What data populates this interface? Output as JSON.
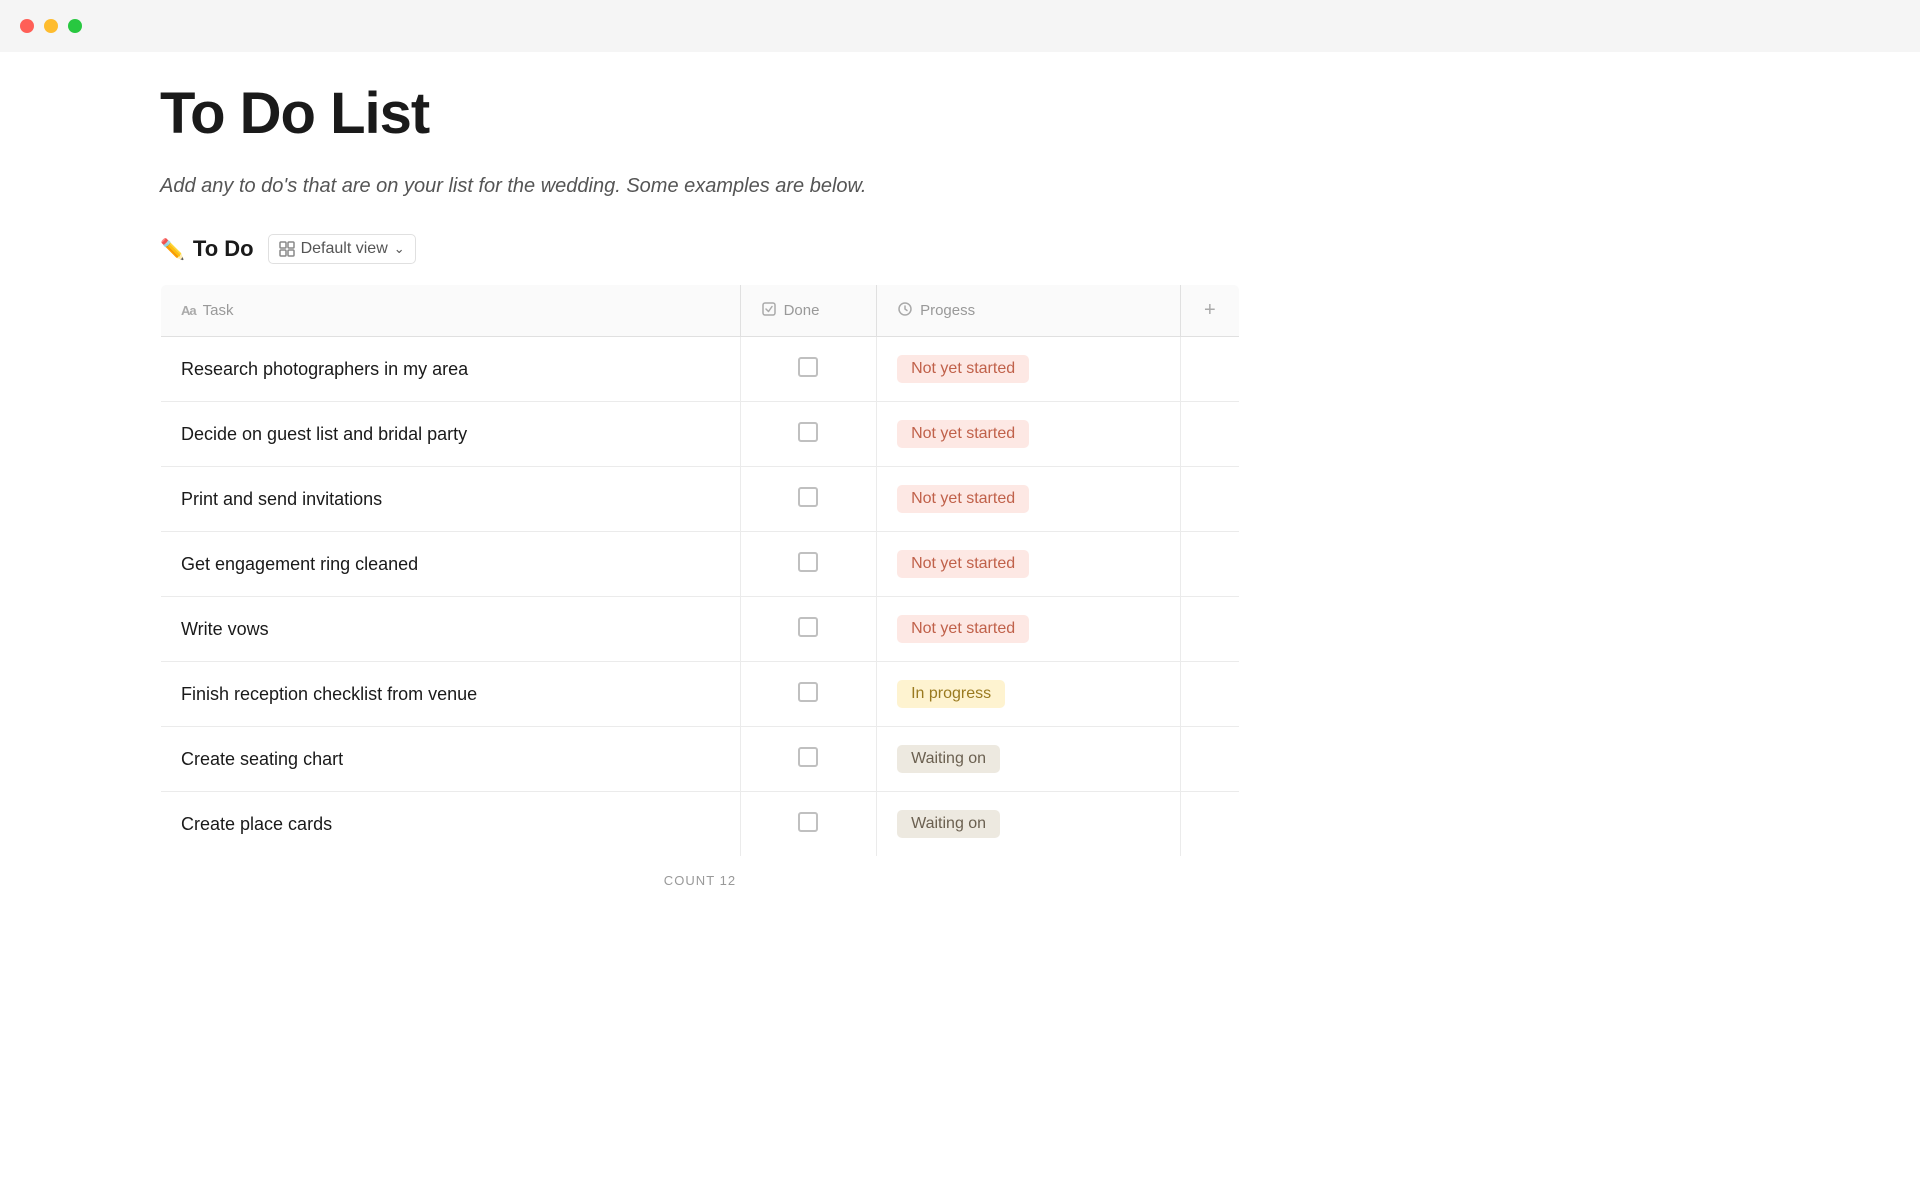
{
  "titlebar": {
    "close_label": "",
    "minimize_label": "",
    "maximize_label": ""
  },
  "page": {
    "title": "To Do List",
    "subtitle": "Add any to do's that are on your list for the wedding. Some examples are below.",
    "db_title": "To Do",
    "db_title_emoji": "✏️",
    "view_label": "Default view",
    "columns": {
      "task": "Task",
      "done": "Done",
      "progress": "Progess",
      "add": "+"
    },
    "footer_count_label": "COUNT",
    "footer_count_value": "12"
  },
  "tasks": [
    {
      "name": "Research photographers in my area",
      "done": false,
      "status": "Not yet started",
      "status_type": "not-started"
    },
    {
      "name": "Decide on guest list and bridal party",
      "done": false,
      "status": "Not yet started",
      "status_type": "not-started"
    },
    {
      "name": "Print and send invitations",
      "done": false,
      "status": "Not yet started",
      "status_type": "not-started"
    },
    {
      "name": "Get engagement ring cleaned",
      "done": false,
      "status": "Not yet started",
      "status_type": "not-started"
    },
    {
      "name": "Write vows",
      "done": false,
      "status": "Not yet started",
      "status_type": "not-started"
    },
    {
      "name": "Finish reception checklist from venue",
      "done": false,
      "status": "In progress",
      "status_type": "in-progress"
    },
    {
      "name": "Create seating chart",
      "done": false,
      "status": "Waiting on",
      "status_type": "waiting"
    },
    {
      "name": "Create place cards",
      "done": false,
      "status": "Waiting on",
      "status_type": "waiting"
    }
  ],
  "icons": {
    "close": "●",
    "minimize": "●",
    "maximize": "●",
    "aa": "Aa",
    "check": "☑",
    "circle": "●",
    "plus": "+",
    "chevron": "⌄"
  }
}
